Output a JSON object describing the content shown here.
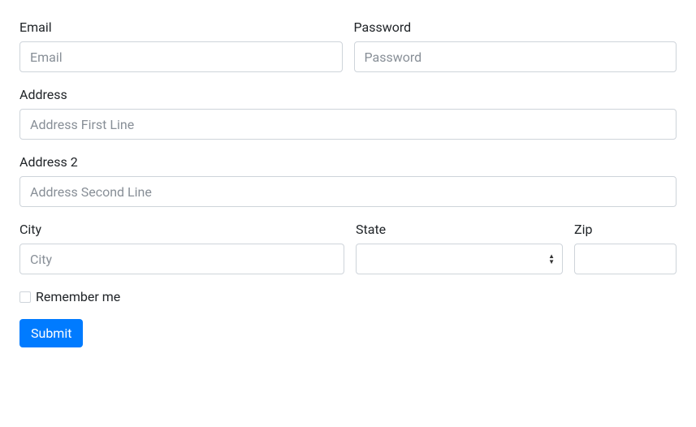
{
  "form": {
    "email": {
      "label": "Email",
      "placeholder": "Email",
      "value": ""
    },
    "password": {
      "label": "Password",
      "placeholder": "Password",
      "value": ""
    },
    "address": {
      "label": "Address",
      "placeholder": "Address First Line",
      "value": ""
    },
    "address2": {
      "label": "Address 2",
      "placeholder": "Address Second Line",
      "value": ""
    },
    "city": {
      "label": "City",
      "placeholder": "City",
      "value": ""
    },
    "state": {
      "label": "State",
      "selected": ""
    },
    "zip": {
      "label": "Zip",
      "value": ""
    },
    "remember": {
      "label": "Remember me",
      "checked": false
    },
    "submit": {
      "label": "Submit"
    }
  }
}
